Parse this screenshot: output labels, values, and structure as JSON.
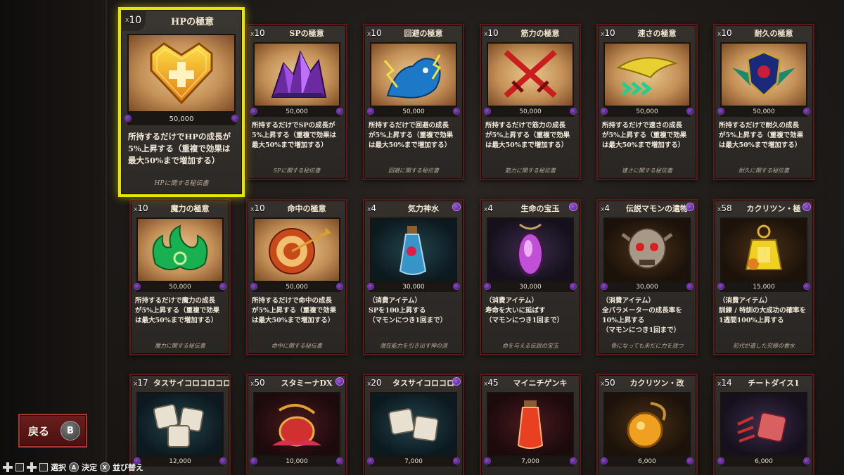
{
  "back_button": {
    "label": "戻る",
    "key": "B"
  },
  "hints": [
    {
      "key": "A",
      "label": "選択"
    },
    {
      "key": "A",
      "label": "決定"
    },
    {
      "key": "X",
      "label": "並び替え"
    }
  ],
  "cards": [
    {
      "id": "hp",
      "count_prefix": "x",
      "count": "10",
      "title": "HPの極意",
      "price": "50,000",
      "desc": "所持するだけでHPの成長が\n5%上昇する（重複で効果は\n最大50%まで増加する）",
      "caption": "HPに関する秘伝書",
      "icon": "heart-plus-icon",
      "selected": true
    },
    {
      "id": "sp",
      "count_prefix": "x",
      "count": "10",
      "title": "SPの極意",
      "price": "50,000",
      "desc": "所持するだけでSPの成長が\n5%上昇する（重複で効果は\n最大50%まで増加する）",
      "caption": "SPに関する秘伝書",
      "icon": "crystal-icon"
    },
    {
      "id": "evasion",
      "count_prefix": "x",
      "count": "10",
      "title": "回避の極意",
      "price": "50,000",
      "desc": "所持するだけで回避の成長\nが5%上昇する（重複で効果\nは最大50%まで増加する）",
      "caption": "回避に関する秘伝書",
      "icon": "lightning-beast-icon"
    },
    {
      "id": "strength",
      "count_prefix": "x",
      "count": "10",
      "title": "筋力の極意",
      "price": "50,000",
      "desc": "所持するだけで筋力の成長\nが5%上昇する（重複で効果\nは最大50%まで増加する）",
      "caption": "筋力に関する秘伝書",
      "icon": "crossed-swords-icon"
    },
    {
      "id": "speed",
      "count_prefix": "x",
      "count": "10",
      "title": "速さの極意",
      "price": "50,000",
      "desc": "所持するだけで速さの成長\nが5%上昇する（重複で効果\nは最大50%まで増加する）",
      "caption": "速さに関する秘伝書",
      "icon": "wind-arrows-icon"
    },
    {
      "id": "endurance",
      "count_prefix": "x",
      "count": "10",
      "title": "耐久の極意",
      "price": "50,000",
      "desc": "所持するだけで耐久の成長\nが5%上昇する（重複で効果\nは最大50%まで増加する）",
      "caption": "耐久に関する秘伝書",
      "icon": "winged-shield-icon"
    },
    {
      "id": "magic",
      "count_prefix": "x",
      "count": "10",
      "title": "魔力の極意",
      "price": "50,000",
      "desc": "所持するだけで魔力の成長\nが5%上昇する（重複で効果\nは最大50%まで増加する）",
      "caption": "魔力に関する秘伝書",
      "icon": "green-flame-icon"
    },
    {
      "id": "accuracy",
      "count_prefix": "x",
      "count": "10",
      "title": "命中の極意",
      "price": "50,000",
      "desc": "所持するだけで命中の成長\nが5%上昇する（重複で効果\nは最大50%まで増加する）",
      "caption": "命中に関する秘伝書",
      "icon": "target-icon"
    },
    {
      "id": "kiryoku",
      "count_prefix": "x",
      "count": "4",
      "title": "気力神水",
      "price": "30,000",
      "desc": "（消費アイテム）\nSPを100上昇する\n（マモンにつき1回まで）",
      "caption": "潜在能力を引き出す神の涙",
      "icon": "potion-bottle-icon",
      "gem": true
    },
    {
      "id": "life-gem",
      "count_prefix": "x",
      "count": "4",
      "title": "生命の宝玉",
      "price": "30,000",
      "desc": "（消費アイテム）\n寿命を大いに延ばす\n（マモンにつき1回まで）",
      "caption": "命を与える伝説の宝玉",
      "icon": "gem-pendant-icon",
      "gem": true
    },
    {
      "id": "relic",
      "count_prefix": "x",
      "count": "4",
      "title": "伝説マモンの遺物",
      "price": "30,000",
      "desc": "（消費アイテム）\n全パラメーターの成長率を\n10%上昇する\n（マモンにつき1回まで）",
      "caption": "骨になっても未だに力を放つ",
      "icon": "skull-relic-icon",
      "gem": true
    },
    {
      "id": "kakuritsun-kyoku",
      "count_prefix": "x",
      "count": "58",
      "title": "カクリツン・極",
      "price": "15,000",
      "desc": "（消費アイテム）\n訓練 / 特訓の大成功の確率を\n1週間100%上昇する",
      "caption": "初代が遺した究極の香水",
      "icon": "golden-perfume-icon",
      "gem": true
    },
    {
      "id": "tasusai-5",
      "count_prefix": "x",
      "count": "17",
      "title": "タスサイコロコロコロ",
      "price": "12,000",
      "icon": "dice-three-icon"
    },
    {
      "id": "stamina-dx",
      "count_prefix": "x",
      "count": "50",
      "title": "スタミーナDX",
      "price": "10,000",
      "icon": "stamina-bottle-icon",
      "gem": true
    },
    {
      "id": "tasusai-3",
      "count_prefix": "x",
      "count": "20",
      "title": "タスサイコロコロ",
      "price": "7,000",
      "icon": "dice-two-icon",
      "gem": true
    },
    {
      "id": "mainichi-genki",
      "count_prefix": "x",
      "count": "45",
      "title": "マイニチゲンキ",
      "price": "7,000",
      "icon": "red-vial-icon"
    },
    {
      "id": "kakuritsun-kai",
      "count_prefix": "x",
      "count": "50",
      "title": "カクリツン・改",
      "price": "6,000",
      "icon": "amber-flask-icon"
    },
    {
      "id": "cheat-dice",
      "count_prefix": "x",
      "count": "14",
      "title": "チートダイス1",
      "price": "6,000",
      "icon": "claw-dice-icon"
    }
  ],
  "colors": {
    "selected_border": "#e6e600",
    "card_border": "#5a1a18",
    "gem": "#9050d0"
  }
}
